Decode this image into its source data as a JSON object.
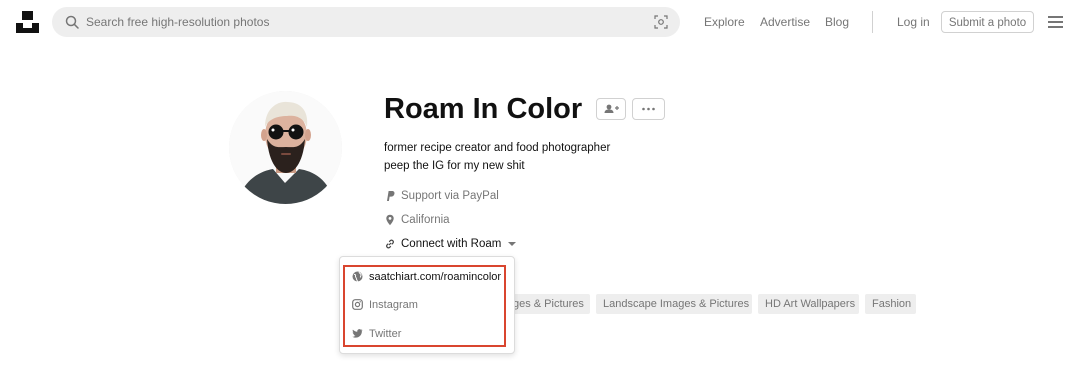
{
  "header": {
    "search": {
      "placeholder": "Search free high-resolution photos",
      "value": ""
    },
    "nav": {
      "explore": "Explore",
      "advertise": "Advertise",
      "blog": "Blog"
    },
    "login": "Log in",
    "submit": "Submit a photo"
  },
  "profile": {
    "name": "Roam In Color",
    "bio_lines": [
      "former recipe creator and food photographer",
      "peep the IG for my new shit"
    ],
    "support": "Support via PayPal",
    "location": "California",
    "connect": "Connect with Roam"
  },
  "tags": [
    "ges & Pictures",
    "Landscape Images & Pictures",
    "HD Art Wallpapers",
    "Fashion"
  ],
  "connect_menu": {
    "items": [
      {
        "label": "saatchiart.com/roamincolor",
        "icon": "globe-icon"
      },
      {
        "label": "Instagram",
        "icon": "instagram-icon"
      },
      {
        "label": "Twitter",
        "icon": "twitter-icon"
      }
    ]
  },
  "colors": {
    "highlight": "#d9452f",
    "muted_text": "#767676",
    "tag_bg": "#eeeeee",
    "search_bg": "#eeeeee"
  }
}
